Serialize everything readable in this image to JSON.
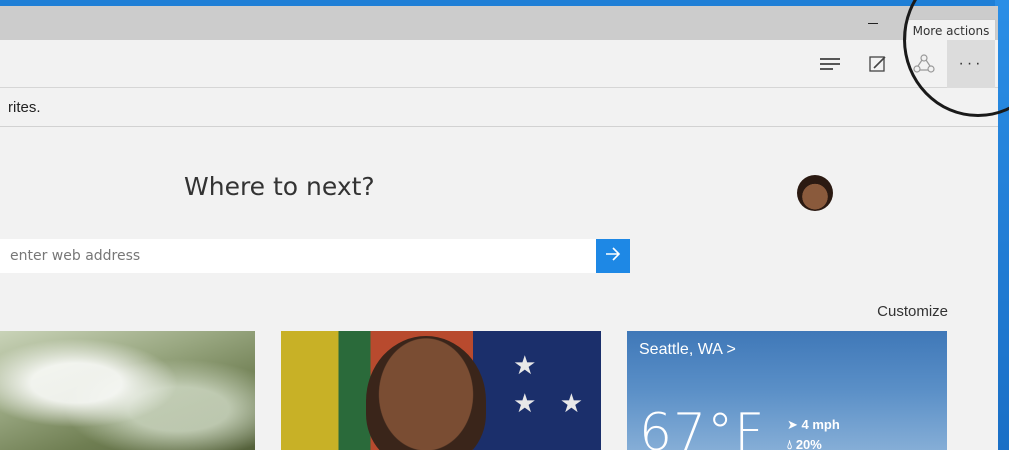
{
  "window": {
    "tooltip": "More actions"
  },
  "toolbar": {
    "hub_icon": "hub-icon",
    "note_icon": "web-note-icon",
    "share_icon": "share-icon",
    "more_icon": "more-actions-icon",
    "more_label": "···"
  },
  "favorites_bar": {
    "text": "rites."
  },
  "new_tab": {
    "heading": "Where to next?",
    "search_placeholder": "enter web address",
    "customize": "Customize"
  },
  "weather": {
    "city": "Seattle, WA >",
    "temperature": "67°F",
    "wind": "4 mph",
    "rain": "20%"
  },
  "colors": {
    "accent": "#1e88e5",
    "desktop": "#1f7fd6"
  }
}
